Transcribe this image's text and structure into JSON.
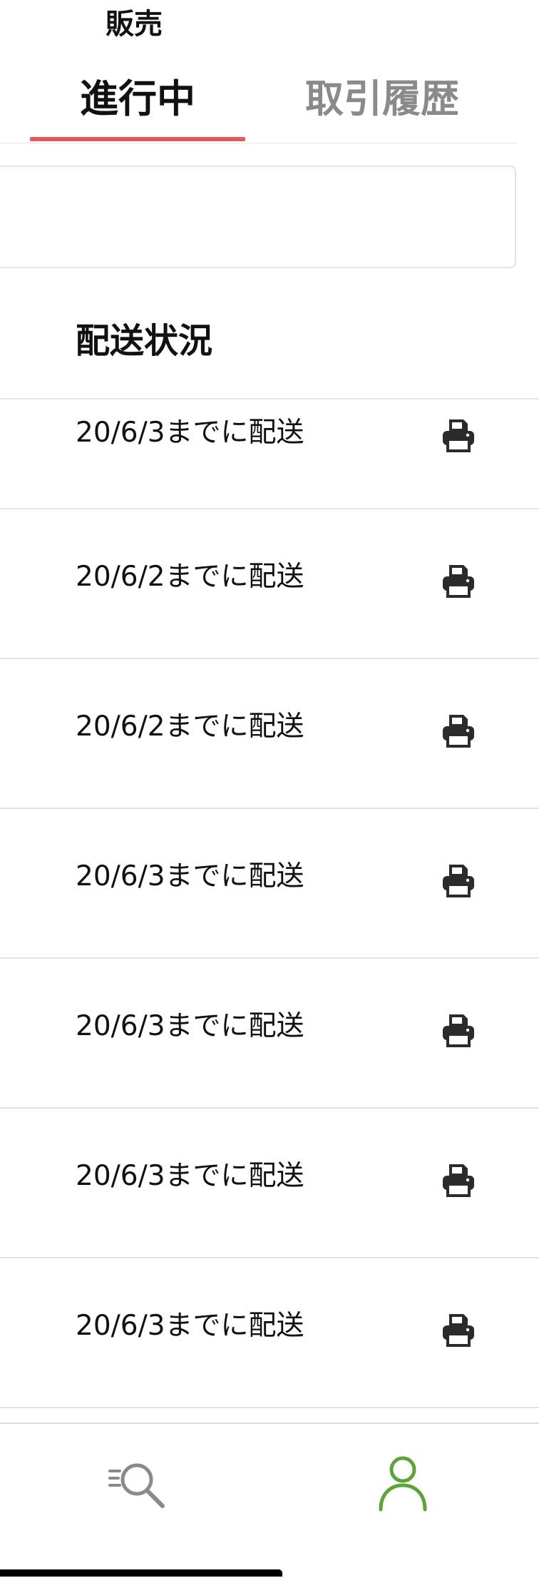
{
  "header": {
    "title": "販売"
  },
  "tabs": [
    {
      "label": "進行中",
      "active": true
    },
    {
      "label": "取引履歴",
      "active": false
    }
  ],
  "colors": {
    "active_tab_underline": "#e05a5f",
    "account_icon": "#5aa43a",
    "search_icon": "#8a8a8a",
    "print_icon": "#2b2b2b"
  },
  "section": {
    "title": "配送状況"
  },
  "shipments": [
    {
      "label": "20/6/3までに配送",
      "icon": "printer-icon"
    },
    {
      "label": "20/6/2までに配送",
      "icon": "printer-icon"
    },
    {
      "label": "20/6/2までに配送",
      "icon": "printer-icon"
    },
    {
      "label": "20/6/3までに配送",
      "icon": "printer-icon"
    },
    {
      "label": "20/6/3までに配送",
      "icon": "printer-icon"
    },
    {
      "label": "20/6/3までに配送",
      "icon": "printer-icon"
    },
    {
      "label": "20/6/3までに配送",
      "icon": "printer-icon"
    }
  ],
  "bottom_nav": [
    {
      "icon": "search-icon",
      "active": false
    },
    {
      "icon": "account-icon",
      "active": true
    }
  ]
}
